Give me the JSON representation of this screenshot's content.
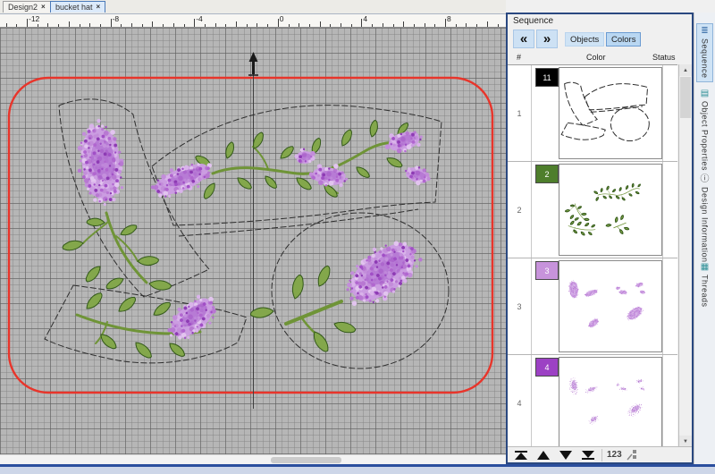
{
  "window": {
    "tabs": [
      {
        "label": "Design2",
        "close_glyph": "×",
        "active": false
      },
      {
        "label": "bucket hat",
        "close_glyph": "×",
        "active": true
      }
    ]
  },
  "ruler": {
    "labels": [
      "-12",
      "-8",
      "-4",
      "0",
      "4",
      "8"
    ]
  },
  "sequence_panel": {
    "title": "Sequence",
    "nav": {
      "back_glyph": "«",
      "forward_glyph": "»"
    },
    "view_buttons": {
      "objects": "Objects",
      "colors": "Colors"
    },
    "columns": {
      "number": "#",
      "color": "Color",
      "status": "Status"
    },
    "rows": [
      {
        "number": "1",
        "swatch_label": "11",
        "swatch_color": "#000000"
      },
      {
        "number": "2",
        "swatch_label": "2",
        "swatch_color": "#4e7e2c"
      },
      {
        "number": "3",
        "swatch_label": "3",
        "swatch_color": "#c793db"
      },
      {
        "number": "4",
        "swatch_label": "4",
        "swatch_color": "#9c41c4"
      }
    ],
    "scrollbar": {
      "up_glyph": "▲",
      "down_glyph": "▼"
    },
    "footer": {
      "stitch_numbers_label": "123"
    }
  },
  "side_tabs": [
    {
      "label": "Sequence",
      "active": true
    },
    {
      "label": "Object Properties",
      "active": false
    },
    {
      "label": "Design Information",
      "active": false
    },
    {
      "label": "Threads",
      "active": false
    }
  ],
  "icons": {
    "sequence_tab": "≣",
    "object_properties_tab": "▤",
    "design_information_tab": "ⓘ",
    "threads_tab": "▦"
  },
  "colors": {
    "hoop_outline": "#e8352b",
    "selection_accent": "#cfe3f5",
    "panel_border": "#2a4880",
    "thread_black": "#000000",
    "thread_green": "#4e7e2c",
    "thread_lilac_light": "#c793db",
    "thread_lilac_dark": "#9c41c4"
  }
}
